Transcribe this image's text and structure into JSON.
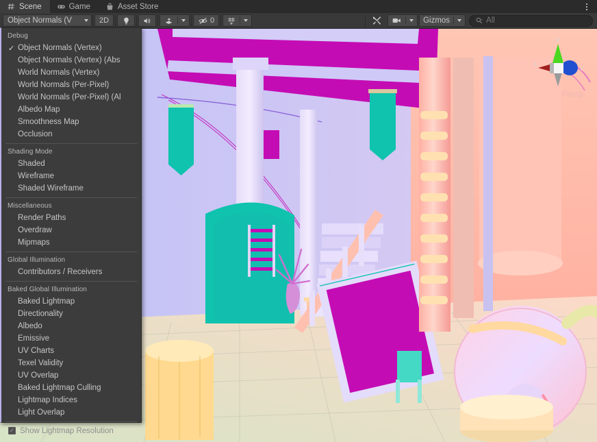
{
  "window": {
    "tabs": [
      {
        "label": "Scene",
        "icon": "grid-icon",
        "active": true
      },
      {
        "label": "Game",
        "icon": "gamepad-icon",
        "active": false
      },
      {
        "label": "Asset Store",
        "icon": "shopping-bag-icon",
        "active": false
      }
    ],
    "kebab": "more-options-icon"
  },
  "toolbar": {
    "draw_mode": "Object Normals (V",
    "two_d": "2D",
    "lighting_icon": "lightbulb-icon",
    "audio_icon": "speaker-icon",
    "fx_icon": "effects-icon",
    "hidden_icon": "hidden-objects-icon",
    "hidden_count": "0",
    "grid_icon": "grid-visibility-icon",
    "tools_icon": "tools-icon",
    "camera_icon": "scene-camera-icon",
    "gizmos": "Gizmos",
    "search_icon": "search-icon",
    "search_placeholder": "All",
    "search_value": ""
  },
  "menu": {
    "sections": [
      {
        "title": "Debug",
        "items": [
          {
            "label": "Object Normals (Vertex)",
            "checked": true
          },
          {
            "label": "Object Normals (Vertex) (Abs",
            "checked": false
          },
          {
            "label": "World Normals (Vertex)",
            "checked": false
          },
          {
            "label": "World Normals (Per-Pixel)",
            "checked": false
          },
          {
            "label": "World Normals (Per-Pixel) (Al",
            "checked": false
          },
          {
            "label": "Albedo Map",
            "checked": false
          },
          {
            "label": "Smoothness Map",
            "checked": false
          },
          {
            "label": "Occlusion",
            "checked": false
          }
        ]
      },
      {
        "title": "Shading Mode",
        "items": [
          {
            "label": "Shaded",
            "checked": false
          },
          {
            "label": "Wireframe",
            "checked": false
          },
          {
            "label": "Shaded Wireframe",
            "checked": false
          }
        ]
      },
      {
        "title": "Miscellaneous",
        "items": [
          {
            "label": "Render Paths",
            "checked": false
          },
          {
            "label": "Overdraw",
            "checked": false
          },
          {
            "label": "Mipmaps",
            "checked": false
          }
        ]
      },
      {
        "title": "Global Illumination",
        "items": [
          {
            "label": "Contributors / Receivers",
            "checked": false
          }
        ]
      },
      {
        "title": "Baked Global Illumination",
        "items": [
          {
            "label": "Baked Lightmap",
            "checked": false
          },
          {
            "label": "Directionality",
            "checked": false
          },
          {
            "label": "Albedo",
            "checked": false
          },
          {
            "label": "Emissive",
            "checked": false
          },
          {
            "label": "UV Charts",
            "checked": false
          },
          {
            "label": "Texel Validity",
            "checked": false
          },
          {
            "label": "UV Overlap",
            "checked": false
          },
          {
            "label": "Baked Lightmap Culling",
            "checked": false
          },
          {
            "label": "Lightmap Indices",
            "checked": false
          },
          {
            "label": "Light Overlap",
            "checked": false
          }
        ]
      }
    ],
    "footer": {
      "label": "Show Lightmap Resolution",
      "checked": true,
      "enabled": false
    }
  },
  "viewport": {
    "gizmo": {
      "x_axis": "x",
      "y_axis": "y",
      "z_axis": "z",
      "projection": "Persp"
    }
  },
  "colors": {
    "chrome": "#393939",
    "tab_active": "#3d3d3d",
    "menu_bg": "#3c3c3c",
    "menu_accent": "#b9b2e8",
    "text": "#c6c6c6",
    "scene_lavender": "#c3c2f5",
    "scene_magenta": "#c40cb4",
    "scene_teal": "#0fc3ae",
    "scene_salmon": "#ffb3a7",
    "axis_x": "#a02020",
    "axis_y": "#4ad820",
    "axis_z": "#2050d0"
  }
}
